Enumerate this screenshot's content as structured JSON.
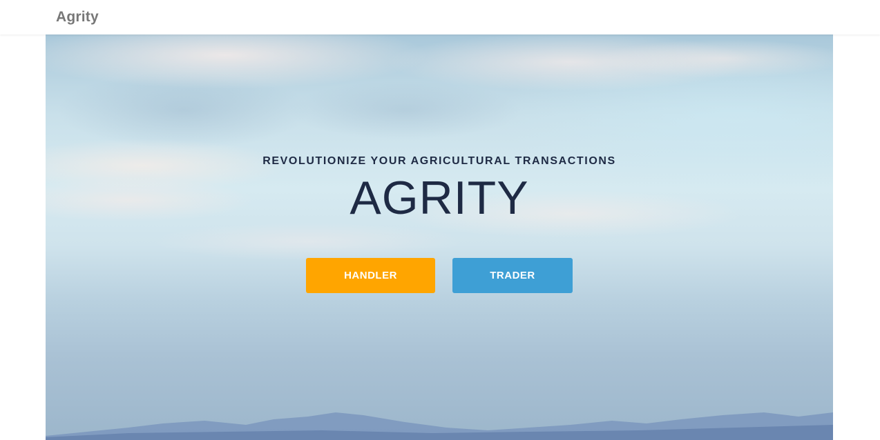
{
  "navbar": {
    "brand": "Agrity"
  },
  "hero": {
    "tagline": "REVOLUTIONIZE YOUR AGRICULTURAL TRANSACTIONS",
    "title": "AGRITY",
    "buttons": [
      {
        "label": "HANDLER",
        "color": "#ffa500"
      },
      {
        "label": "TRADER",
        "color": "#3e9fd5"
      }
    ]
  },
  "colors": {
    "brand_text": "#777777",
    "heading_text": "#1e2a44",
    "sky_light": "#d6eaf1",
    "mountains": "#6f8cb5"
  }
}
